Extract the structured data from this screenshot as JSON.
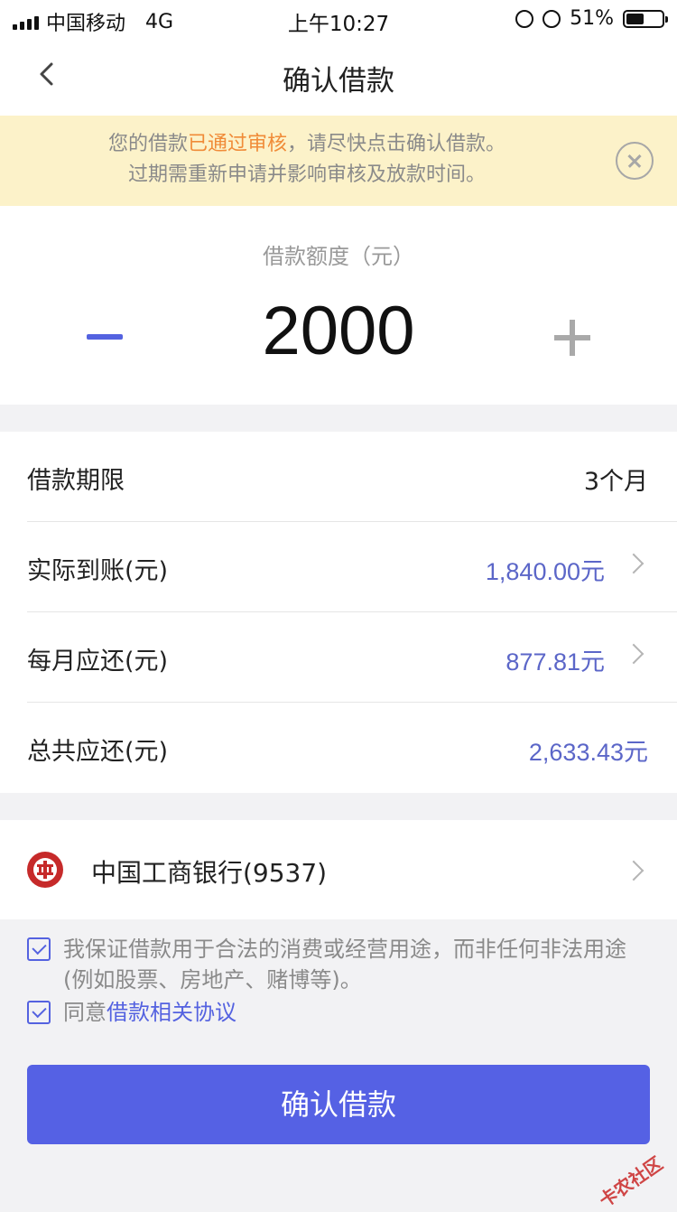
{
  "status_bar": {
    "carrier": "中国移动",
    "network": "4G",
    "time": "上午10:27",
    "battery_percent": "51%",
    "battery_level": 0.51
  },
  "nav": {
    "title": "确认借款"
  },
  "notice": {
    "line1_prefix": "您的借款",
    "line1_highlight": "已通过审核",
    "line1_suffix": "，请尽快点击确认借款。",
    "line2": "过期需重新申请并影响审核及放款时间。"
  },
  "amount": {
    "label": "借款额度（元）",
    "value": "2000"
  },
  "details": [
    {
      "label": "借款期限",
      "value": "3个月"
    },
    {
      "label": "实际到账(元)",
      "value": "1,840.00元"
    },
    {
      "label": "每月应还(元)",
      "value": "877.81元"
    },
    {
      "label": "总共应还(元)",
      "value": "2,633.43元"
    }
  ],
  "bank": {
    "name": "中国工商银行(9537)"
  },
  "agreements": {
    "pledge": "我保证借款用于合法的消费或经营用途，而非任何非法用途(例如股票、房地产、赌博等)。",
    "consent_prefix": "同意",
    "consent_link": "借款相关协议"
  },
  "confirm_button": "确认借款",
  "watermark": "卡农社区",
  "colors": {
    "accent": "#5561e4",
    "highlight": "#f08b38",
    "notice_bg": "#fcf2c9"
  }
}
